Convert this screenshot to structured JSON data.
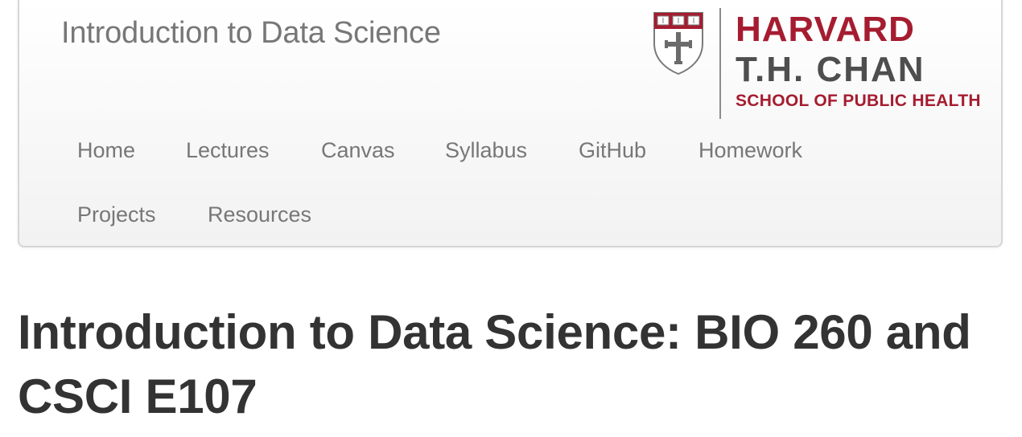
{
  "navbar": {
    "brand": "Introduction to Data Science",
    "items": [
      {
        "label": "Home"
      },
      {
        "label": "Lectures"
      },
      {
        "label": "Canvas"
      },
      {
        "label": "Syllabus"
      },
      {
        "label": "GitHub"
      },
      {
        "label": "Homework"
      },
      {
        "label": "Projects"
      },
      {
        "label": "Resources"
      }
    ]
  },
  "logo": {
    "line1": "HARVARD",
    "line2": "T.H. CHAN",
    "line3": "SCHOOL OF PUBLIC HEALTH",
    "shield_text": [
      "VE",
      "RI",
      "TAS"
    ],
    "icon": "harvard-shield-icon",
    "colors": {
      "crimson": "#a51c30",
      "dark_gray": "#4e4e4e"
    }
  },
  "page": {
    "title": "Introduction to Data Science: BIO 260 and CSCI E107"
  },
  "colors": {
    "nav_text": "#777777",
    "title_text": "#333333"
  }
}
